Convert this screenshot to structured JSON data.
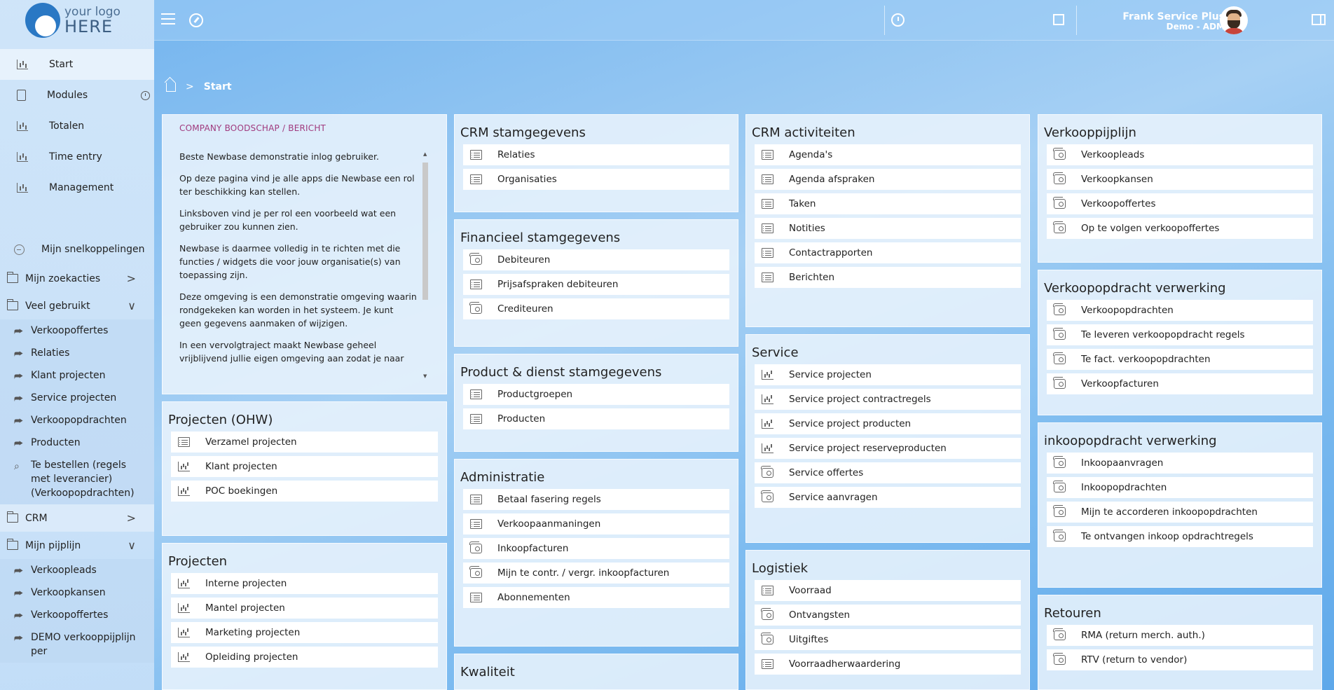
{
  "logo": {
    "line1": "your logo",
    "line2": "HERE"
  },
  "sidebar": {
    "main": [
      {
        "label": "Start",
        "icon": "chart-icon"
      },
      {
        "label": "Modules",
        "icon": "book-icon"
      },
      {
        "label": "Totalen",
        "icon": "chart-icon"
      },
      {
        "label": "Time entry",
        "icon": "chart-icon"
      },
      {
        "label": "Management",
        "icon": "chart-icon"
      }
    ],
    "shortcuts_label": "Mijn snelkoppelingen",
    "folders": {
      "searches": "Mijn zoekacties",
      "frequent": "Veel gebruikt",
      "crm": "CRM",
      "pipeline": "Mijn pijplijn"
    },
    "frequent_items": [
      "Verkoopoffertes",
      "Relaties",
      "Klant projecten",
      "Service projecten",
      "Verkoopopdrachten",
      "Producten",
      "Te bestellen (regels met leverancier) (Verkoopopdrachten)"
    ],
    "pipeline_items": [
      "Verkoopleads",
      "Verkoopkansen",
      "Verkoopoffertes",
      "DEMO verkooppijplijn per"
    ]
  },
  "topbar": {
    "user_name": "Frank Service Plus",
    "user_role": "Demo - ADM"
  },
  "breadcrumb": {
    "current": "Start"
  },
  "message": {
    "title": "COMPANY BOODSCHAP / BERICHT",
    "paragraphs": [
      "Beste Newbase demonstratie inlog gebruiker.",
      "Op deze pagina vind je alle apps die Newbase een rol ter beschikking kan stellen.",
      "Linksboven vind je per rol een voorbeeld wat een gebruiker zou kunnen zien.",
      "Newbase is daarmee volledig in te richten met die functies / widgets die voor jouw organisatie(s) van toepassing zijn.",
      "Deze omgeving is een demonstratie omgeving waarin rondgekeken kan worden in het systeem. Je kunt geen gegevens aanmaken of wijzigen.",
      "In een vervolgtraject maakt Newbase geheel vrijblijvend jullie eigen omgeving aan zodat je naar"
    ]
  },
  "cards": {
    "projecten_ohw": {
      "title": "Projecten (OHW)",
      "rows": [
        [
          "Verzamel projecten",
          "list"
        ],
        [
          "Klant projecten",
          "chart"
        ],
        [
          "POC boekingen",
          "chart"
        ]
      ]
    },
    "projecten": {
      "title": "Projecten",
      "rows": [
        [
          "Interne projecten",
          "chart"
        ],
        [
          "Mantel projecten",
          "chart"
        ],
        [
          "Marketing projecten",
          "chart"
        ],
        [
          "Opleiding projecten",
          "chart"
        ]
      ]
    },
    "crm_stam": {
      "title": "CRM stamgegevens",
      "rows": [
        [
          "Relaties",
          "list"
        ],
        [
          "Organisaties",
          "list"
        ]
      ]
    },
    "fin_stam": {
      "title": "Financieel stamgegevens",
      "rows": [
        [
          "Debiteuren",
          "wallet"
        ],
        [
          "Prijsafspraken debiteuren",
          "list"
        ],
        [
          "Crediteuren",
          "wallet"
        ]
      ]
    },
    "product_stam": {
      "title": "Product & dienst stamgegevens",
      "rows": [
        [
          "Productgroepen",
          "list"
        ],
        [
          "Producten",
          "list"
        ]
      ]
    },
    "administratie": {
      "title": "Administratie",
      "rows": [
        [
          "Betaal fasering regels",
          "list"
        ],
        [
          "Verkoopaanmaningen",
          "list"
        ],
        [
          "Inkoopfacturen",
          "wallet"
        ],
        [
          "Mijn te contr. / vergr. inkoopfacturen",
          "wallet"
        ],
        [
          "Abonnementen",
          "list"
        ]
      ]
    },
    "kwaliteit": {
      "title": "Kwaliteit",
      "rows": []
    },
    "crm_act": {
      "title": "CRM activiteiten",
      "rows": [
        [
          "Agenda's",
          "list"
        ],
        [
          "Agenda afspraken",
          "list"
        ],
        [
          "Taken",
          "list"
        ],
        [
          "Notities",
          "list"
        ],
        [
          "Contactrapporten",
          "list"
        ],
        [
          "Berichten",
          "list"
        ]
      ]
    },
    "service": {
      "title": "Service",
      "rows": [
        [
          "Service projecten",
          "chart"
        ],
        [
          "Service project contractregels",
          "chart"
        ],
        [
          "Service project producten",
          "chart"
        ],
        [
          "Service project reserveproducten",
          "chart"
        ],
        [
          "Service offertes",
          "wallet"
        ],
        [
          "Service aanvragen",
          "wallet"
        ]
      ]
    },
    "logistiek": {
      "title": "Logistiek",
      "rows": [
        [
          "Voorraad",
          "list"
        ],
        [
          "Ontvangsten",
          "wallet"
        ],
        [
          "Uitgiftes",
          "wallet"
        ],
        [
          "Voorraadherwaardering",
          "list"
        ]
      ]
    },
    "verkooppijplijn": {
      "title": "Verkooppijplijn",
      "rows": [
        [
          "Verkoopleads",
          "wallet"
        ],
        [
          "Verkoopkansen",
          "wallet"
        ],
        [
          "Verkoopoffertes",
          "wallet"
        ],
        [
          "Op te volgen verkoopoffertes",
          "wallet"
        ]
      ]
    },
    "verkoopopdracht": {
      "title": "Verkoopopdracht verwerking",
      "rows": [
        [
          "Verkoopopdrachten",
          "wallet"
        ],
        [
          "Te leveren verkoopopdracht regels",
          "wallet"
        ],
        [
          "Te fact. verkoopopdrachten",
          "wallet"
        ],
        [
          "Verkoopfacturen",
          "wallet"
        ]
      ]
    },
    "inkoopopdracht": {
      "title": "inkoopopdracht verwerking",
      "rows": [
        [
          "Inkoopaanvragen",
          "wallet"
        ],
        [
          "Inkoopopdrachten",
          "wallet"
        ],
        [
          "Mijn te accorderen inkoopopdrachten",
          "wallet"
        ],
        [
          "Te ontvangen inkoop opdrachtregels",
          "wallet"
        ]
      ]
    },
    "retouren": {
      "title": "Retouren",
      "rows": [
        [
          "RMA (return merch. auth.)",
          "wallet"
        ],
        [
          "RTV (return to vendor)",
          "wallet"
        ]
      ]
    }
  }
}
